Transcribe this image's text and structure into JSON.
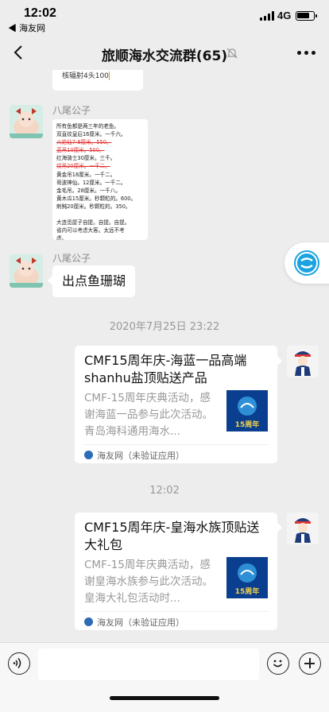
{
  "status": {
    "time": "12:02",
    "back_app": "◀ 海友网",
    "network": "4G"
  },
  "nav": {
    "title": "旅顺海水交流群(65)"
  },
  "chat": {
    "prev_message": "核辐射4头100",
    "messages": [
      {
        "sender": "八尾公子",
        "image_lines": [
          {
            "text": "所有鱼都是两三年的老鱼。",
            "strike": false
          },
          {
            "text": "双直纹皇后16厘米。一千六。",
            "strike": false
          },
          {
            "text": "火焰仙7-8厘米。550。",
            "strike": true
          },
          {
            "text": "蓝吊10厘米。500。",
            "strike": true
          },
          {
            "text": "红海骑士30厘米。三千。",
            "strike": false
          },
          {
            "text": "纹吊20厘米。一千二。",
            "strike": true
          },
          {
            "text": "黄金吊18厘米。一千二。",
            "strike": false
          },
          {
            "text": "哥波神仙。12厘米。一千二。",
            "strike": false
          },
          {
            "text": "金毛吊。28厘米。一千八。",
            "strike": false
          },
          {
            "text": "黄木瓜15厘米。秒颗粒的。600。",
            "strike": false
          },
          {
            "text": "剌鲀20厘米。秒颗粒的。350。",
            "strike": false
          },
          {
            "text": "",
            "strike": false
          },
          {
            "text": "大连觅屋子自提。自提。自提。",
            "strike": false
          },
          {
            "text": "省内可以考虑大客。太远不考",
            "strike": false
          },
          {
            "text": "虑。",
            "strike": false
          }
        ]
      },
      {
        "sender": "八尾公子",
        "text": "出点鱼珊瑚"
      }
    ],
    "timestamps": [
      "2020年7月25日 23:22",
      "12:02"
    ],
    "cards": [
      {
        "title": "CMF15周年庆-海蓝一品高端shanhu盐顶贴送产品",
        "desc": "CMF-15周年庆典活动，感谢海蓝一品参与此次活动。青岛海科通用海水...",
        "thumb_label": "15周年",
        "source": "海友网（未验证应用）"
      },
      {
        "title": "CMF15周年庆-皇海水族顶贴送大礼包",
        "desc": "CMF-15周年庆典活动，感谢皇海水族参与此次活动。皇海大礼包活动时...",
        "thumb_label": "15周年",
        "source": "海友网（未验证应用）"
      }
    ]
  },
  "icons": [
    "back-icon",
    "mute-icon",
    "more-icon",
    "voice-icon",
    "emoji-icon",
    "plus-icon",
    "floating-app-icon"
  ],
  "colors": {
    "background": "#ededed",
    "bubble": "#ffffff",
    "strike": "#e03030",
    "thumb": "#0a3f8f",
    "float": "#1aa3e0"
  }
}
